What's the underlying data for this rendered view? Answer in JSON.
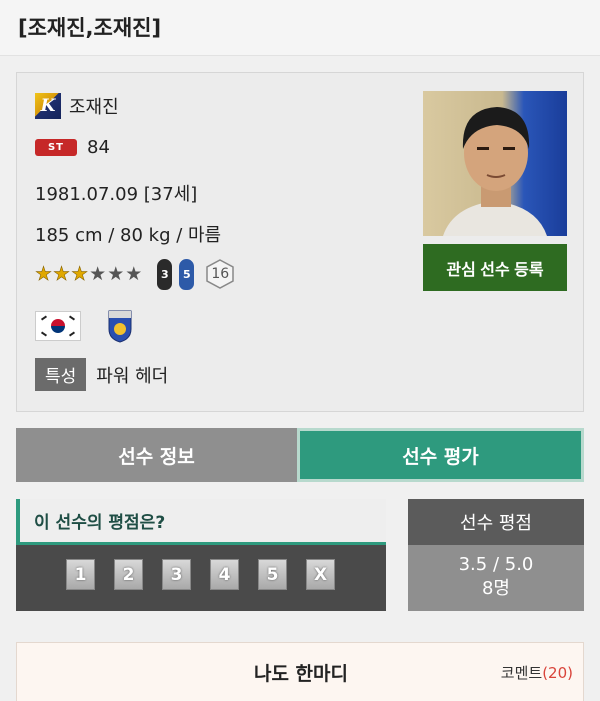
{
  "page_title": "[조재진,조재진]",
  "player": {
    "name": "조재진",
    "position": "ST",
    "overall": "84",
    "birth": "1981.07.09 [37세]",
    "body": "185 cm / 80 kg / 마름",
    "stars_on": 3,
    "stars_total": 6,
    "weak_foot_left": "3",
    "weak_foot_right": "5",
    "level": "16",
    "trait_label": "특성",
    "trait_value": "파워 헤더",
    "favorite_button": "관심 선수 등록"
  },
  "tabs": [
    {
      "label": "선수 정보",
      "active": false
    },
    {
      "label": "선수 평가",
      "active": true
    }
  ],
  "rating": {
    "question": "이 선수의 평점은?",
    "options": [
      "1",
      "2",
      "3",
      "4",
      "5",
      "X"
    ]
  },
  "score": {
    "title": "선수 평점",
    "value": "3.5 / 5.0",
    "count": "8명"
  },
  "comments": {
    "title": "나도 한마디",
    "count_label": "코멘트",
    "count": "(20)"
  },
  "colors": {
    "accent_green": "#2e9a7e",
    "button_green": "#2e6b21",
    "position_red": "#c62828"
  }
}
